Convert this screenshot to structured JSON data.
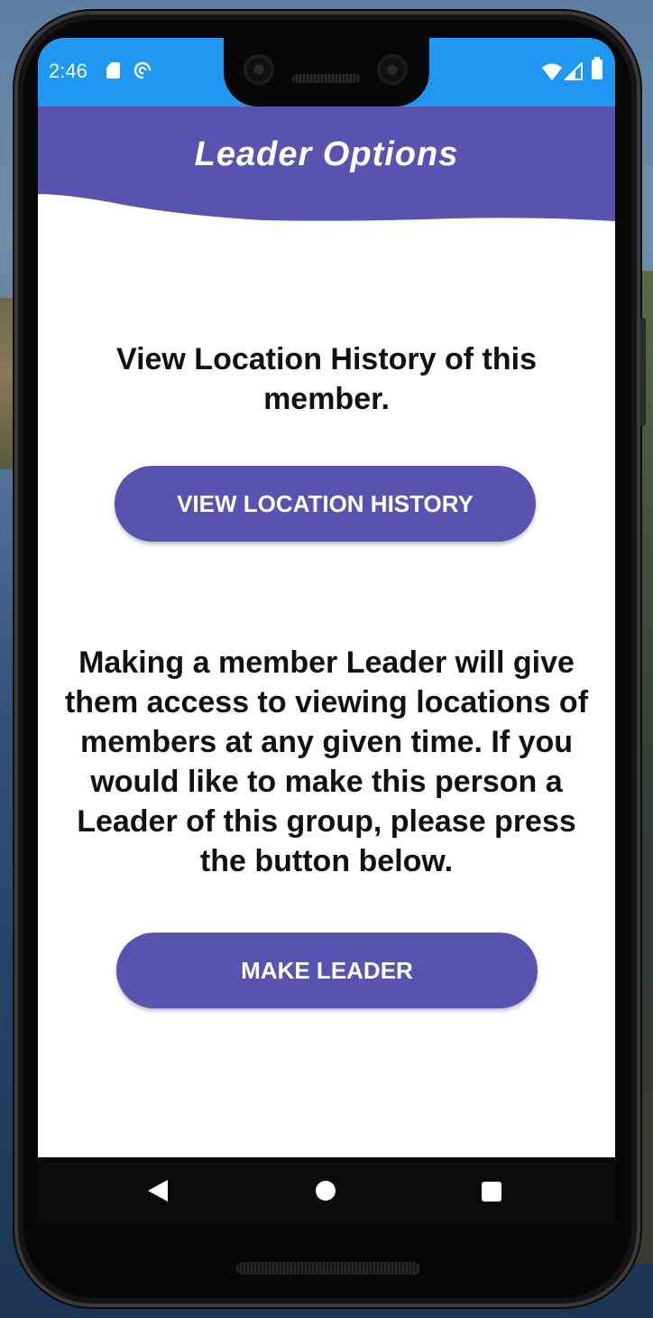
{
  "status_bar": {
    "time": "2:46",
    "icons": [
      "sd-card-icon",
      "sync-icon",
      "wifi-icon",
      "signal-icon",
      "battery-icon"
    ]
  },
  "header": {
    "title": "Leader Options",
    "color": "#5853b0"
  },
  "main": {
    "location_info": "View Location History of this member.",
    "view_history_button": "VIEW LOCATION HISTORY",
    "leader_info": "Making a member Leader will give them access to viewing locations of members at any given time. If you would like to make this person a Leader of this group, please press the button below.",
    "make_leader_button": "MAKE LEADER"
  },
  "nav_bar": {
    "icons": [
      "back-icon",
      "home-icon",
      "recents-icon"
    ]
  },
  "colors": {
    "status_bar": "#1e98f3",
    "accent": "#5853b0",
    "background": "#ffffff"
  }
}
